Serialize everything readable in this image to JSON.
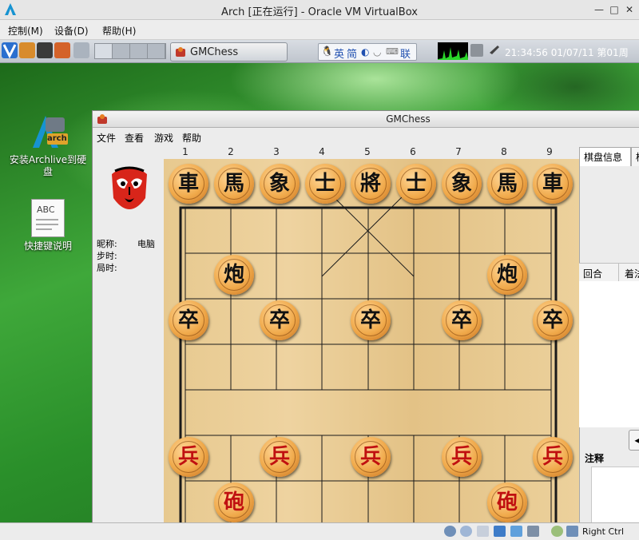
{
  "vbox": {
    "title": "Arch [正在运行] - Oracle VM VirtualBox",
    "menus": [
      "控制(M)",
      "设备(D)",
      "帮助(H)"
    ],
    "host_key": "Right Ctrl"
  },
  "panel": {
    "task_label": "GMChess",
    "ime": {
      "lang": "英",
      "mode": "简",
      "status": "联"
    },
    "clock": "21:34:56 01/07/11 第01周"
  },
  "desktop": {
    "icons": [
      {
        "label": "安装Archlive到硬盘",
        "badge": "arch"
      },
      {
        "label": "快捷键说明",
        "badge": "ABC"
      }
    ]
  },
  "gmchess": {
    "title": "GMChess",
    "menus": [
      "文件",
      "查看",
      "游戏",
      "帮助"
    ],
    "player": {
      "nickname_label": "昵称:",
      "nickname": "电脑",
      "step_time_label": "步时:",
      "game_time_label": "局时:"
    },
    "column_numbers": [
      "1",
      "2",
      "3",
      "4",
      "5",
      "6",
      "7",
      "8",
      "9"
    ],
    "board_pieces": [
      {
        "text": "車",
        "side": "black"
      },
      {
        "text": "馬",
        "side": "black"
      },
      {
        "text": "象",
        "side": "black"
      },
      {
        "text": "士",
        "side": "black"
      },
      {
        "text": "將",
        "side": "black"
      },
      {
        "text": "士",
        "side": "black"
      },
      {
        "text": "象",
        "side": "black"
      },
      {
        "text": "馬",
        "side": "black"
      },
      {
        "text": "車",
        "side": "black"
      },
      {
        "text": "炮",
        "side": "black"
      },
      {
        "text": "炮",
        "side": "black"
      },
      {
        "text": "卒",
        "side": "black"
      },
      {
        "text": "卒",
        "side": "black"
      },
      {
        "text": "卒",
        "side": "black"
      },
      {
        "text": "卒",
        "side": "black"
      },
      {
        "text": "卒",
        "side": "black"
      },
      {
        "text": "兵",
        "side": "red"
      },
      {
        "text": "兵",
        "side": "red"
      },
      {
        "text": "兵",
        "side": "red"
      },
      {
        "text": "兵",
        "side": "red"
      },
      {
        "text": "兵",
        "side": "red"
      },
      {
        "text": "砲",
        "side": "red"
      },
      {
        "text": "砲",
        "side": "red"
      }
    ],
    "tabs": [
      "棋盘信息",
      "棋"
    ],
    "moves_columns": [
      "回合",
      "着法"
    ],
    "notes_label": "注释"
  },
  "colors": {
    "red_piece": "#c01010",
    "black_piece": "#111111",
    "board": "#e7c98f"
  }
}
